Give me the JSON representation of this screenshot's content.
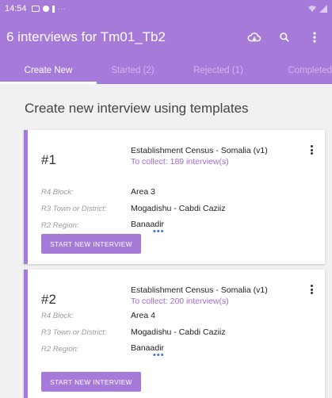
{
  "status_bar": {
    "time": "14:54",
    "extra": "···"
  },
  "app_bar": {
    "title": "6 interviews for Tm01_Tb2"
  },
  "tabs": [
    {
      "label": "Create New",
      "active": true
    },
    {
      "label": "Started (2)",
      "active": false
    },
    {
      "label": "Rejected (1)",
      "active": false
    },
    {
      "label": "Completed",
      "active": false
    }
  ],
  "section_title": "Create new interview using templates",
  "cards": [
    {
      "number": "#1",
      "template": "Establishment Census - Somalia (v1)",
      "to_collect": "To collect: 189 interview(s)",
      "fields": [
        {
          "label": "R4 Block:",
          "value": "Area 3"
        },
        {
          "label": "R3 Town or District:",
          "value": "Mogadishu - Cabdi Caziiz"
        },
        {
          "label": "R2 Region:",
          "value": "Banaadir"
        }
      ],
      "more": "•••",
      "button": "START NEW INTERVIEW"
    },
    {
      "number": "#2",
      "template": "Establishment Census - Somalia (v1)",
      "to_collect": "To collect: 200 interview(s)",
      "fields": [
        {
          "label": "R4 Block:",
          "value": "Area 4"
        },
        {
          "label": "R3 Town or District:",
          "value": "Mogadishu - Cabdi Caziiz"
        },
        {
          "label": "R2 Region:",
          "value": "Banaadir"
        }
      ],
      "more": "•••",
      "button": "START NEW INTERVIEW"
    }
  ],
  "icons": [
    "cloud-sync-icon",
    "search-icon",
    "more-vert-icon"
  ],
  "colors": {
    "primary": "#a67ad9",
    "accent_text": "#a06ad6",
    "dots": "#3f6ec7"
  }
}
